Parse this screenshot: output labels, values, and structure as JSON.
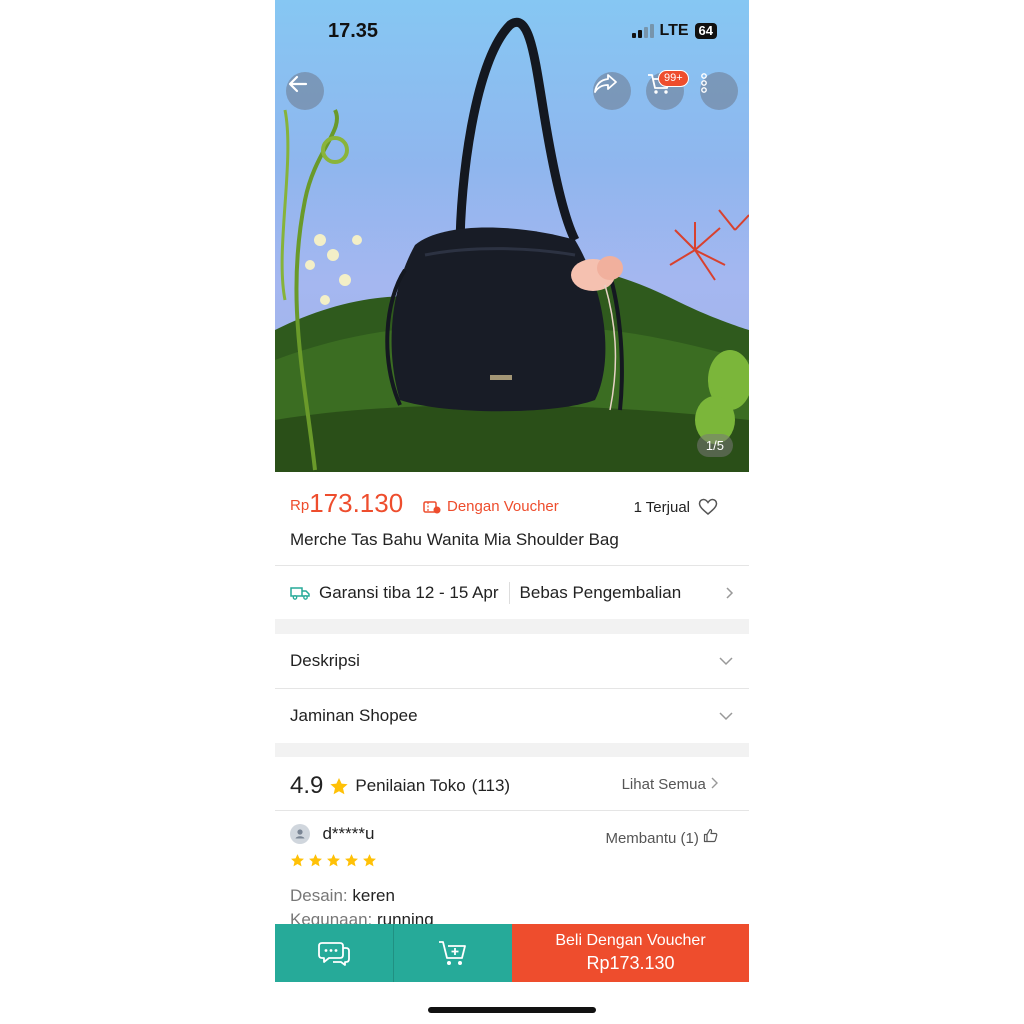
{
  "status_bar": {
    "time": "17.35",
    "network": "LTE",
    "battery": "64"
  },
  "header": {
    "cart_badge": "99+"
  },
  "gallery": {
    "counter": "1/5"
  },
  "product": {
    "currency": "Rp",
    "price": "173.130",
    "voucher_label": "Dengan Voucher",
    "sold": "1 Terjual",
    "title": "Merche Tas Bahu Wanita Mia Shoulder Bag"
  },
  "shipping": {
    "guarantee": "Garansi tiba 12 - 15 Apr",
    "returns": "Bebas Pengembalian"
  },
  "sections": {
    "description": "Deskripsi",
    "guarantee": "Jaminan Shopee"
  },
  "ratings": {
    "score": "4.9",
    "label": "Penilaian Toko",
    "count": "(113)",
    "see_all": "Lihat Semua"
  },
  "review": {
    "user": "d*****u",
    "helpful": "Membantu (1)",
    "stars": 5,
    "design_key": "Desain:",
    "design_val": "keren",
    "use_key": "Kegunaan:",
    "use_val": "running"
  },
  "bottom": {
    "buy_label": "Beli Dengan Voucher",
    "buy_price": "Rp173.130"
  },
  "colors": {
    "accent": "#ee4d2d",
    "teal": "#26aa99",
    "star": "#ffc107"
  }
}
